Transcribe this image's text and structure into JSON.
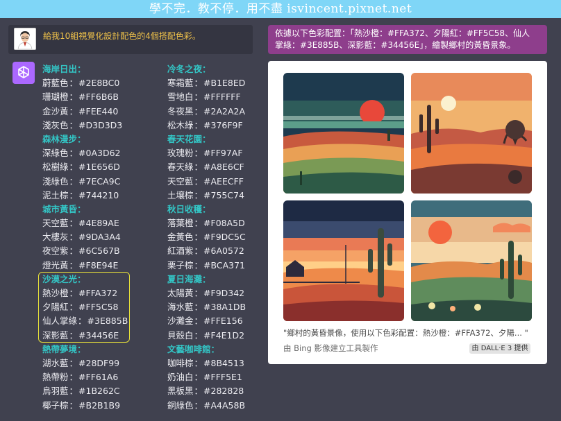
{
  "banner": {
    "text": "學不完．教不停．用不盡 isvincent.pixnet.net"
  },
  "user_message": {
    "text": "給我10組視覺化設計配色的4個搭配色彩。"
  },
  "palettes_left": [
    {
      "title": "海岸日出：",
      "colors": [
        {
          "name": "蔚藍色",
          "hex": "#2E8BC0"
        },
        {
          "name": "珊瑚橙",
          "hex": "#FF6B6B"
        },
        {
          "name": "金沙黃",
          "hex": "#FEE440"
        },
        {
          "name": "淺灰色",
          "hex": "#D3D3D3"
        }
      ]
    },
    {
      "title": "森林漫步：",
      "colors": [
        {
          "name": "深綠色",
          "hex": "#0A3D62"
        },
        {
          "name": "松樹綠",
          "hex": "#1E656D"
        },
        {
          "name": "淺綠色",
          "hex": "#7ECA9C"
        },
        {
          "name": "泥土棕",
          "hex": "#744210"
        }
      ]
    },
    {
      "title": "城市黃昏：",
      "colors": [
        {
          "name": "天空藍",
          "hex": "#4E89AE"
        },
        {
          "name": "大樓灰",
          "hex": "#9DA3A4"
        },
        {
          "name": "夜空紫",
          "hex": "#6C567B"
        },
        {
          "name": "燈光黃",
          "hex": "#F8E94E"
        }
      ]
    },
    {
      "title": "沙漠之光：",
      "colors": [
        {
          "name": "熱沙橙",
          "hex": "#FFA372"
        },
        {
          "name": "夕陽紅",
          "hex": "#FF5C58"
        },
        {
          "name": "仙人掌綠",
          "hex": "#3E885B"
        },
        {
          "name": "深影藍",
          "hex": "#34456E"
        }
      ]
    },
    {
      "title": "熱帶夢境：",
      "colors": [
        {
          "name": "湖水藍",
          "hex": "#28DF99"
        },
        {
          "name": "熱帶粉",
          "hex": "#FF61A6"
        },
        {
          "name": "烏羽藍",
          "hex": "#1B262C"
        },
        {
          "name": "椰子棕",
          "hex": "#B2B1B9"
        }
      ]
    }
  ],
  "palettes_right": [
    {
      "title": "冷冬之夜：",
      "colors": [
        {
          "name": "寒霜藍",
          "hex": "#B1E8ED"
        },
        {
          "name": "雪地白",
          "hex": "#FFFFFF"
        },
        {
          "name": "冬夜黑",
          "hex": "#2A2A2A"
        },
        {
          "name": "松木綠",
          "hex": "#376F9F"
        }
      ]
    },
    {
      "title": "春天花園：",
      "colors": [
        {
          "name": "玫瑰粉",
          "hex": "#FF97AF"
        },
        {
          "name": "春天綠",
          "hex": "#A8E6CF"
        },
        {
          "name": "天空藍",
          "hex": "#AEECFF"
        },
        {
          "name": "土壤棕",
          "hex": "#755C74"
        }
      ]
    },
    {
      "title": "秋日收穫：",
      "colors": [
        {
          "name": "落葉橙",
          "hex": "#F08A5D"
        },
        {
          "name": "金黃色",
          "hex": "#F9DC5C"
        },
        {
          "name": "紅酒紫",
          "hex": "#6A0572"
        },
        {
          "name": "栗子棕",
          "hex": "#BCA371"
        }
      ]
    },
    {
      "title": "夏日海灘：",
      "colors": [
        {
          "name": "太陽黃",
          "hex": "#F9D342"
        },
        {
          "name": "海水藍",
          "hex": "#38A1DB"
        },
        {
          "name": "沙灘金",
          "hex": "#FFE156"
        },
        {
          "name": "貝殼白",
          "hex": "#F4E1D2"
        }
      ]
    },
    {
      "title": "文藝咖啡館：",
      "colors": [
        {
          "name": "咖啡棕",
          "hex": "#8B4513"
        },
        {
          "name": "奶油白",
          "hex": "#FFF5E1"
        },
        {
          "name": "黑板黑",
          "hex": "#282828"
        },
        {
          "name": "銅綠色",
          "hex": "#A4A58B"
        }
      ]
    }
  ],
  "prompt": {
    "line1": "依據以下色彩配置：「熱沙橙：#FFA372、夕陽紅：#FF5C58、仙人",
    "line2": "掌綠：#3E885B、深影藍：#34456E」，繪製鄉村的黃昏景象。"
  },
  "result_card": {
    "caption": "\"鄉村的黃昏景像，使用以下色彩配置：熱沙橙：#FFA372、夕陽... \"",
    "credit": "由 Bing 影像建立工具製作",
    "badge": "由 DALL·E 3 提供"
  },
  "colors": {
    "banner_bg": "#7fd6f7",
    "page_bg": "#40414f",
    "message_bg": "#343541",
    "prompt_bg": "#8e3e8c",
    "heading": "#33c6c6",
    "user_text": "#f0c24a",
    "highlight_border": "#e7e13a",
    "gpt_icon_bg": "#ab68ff"
  }
}
